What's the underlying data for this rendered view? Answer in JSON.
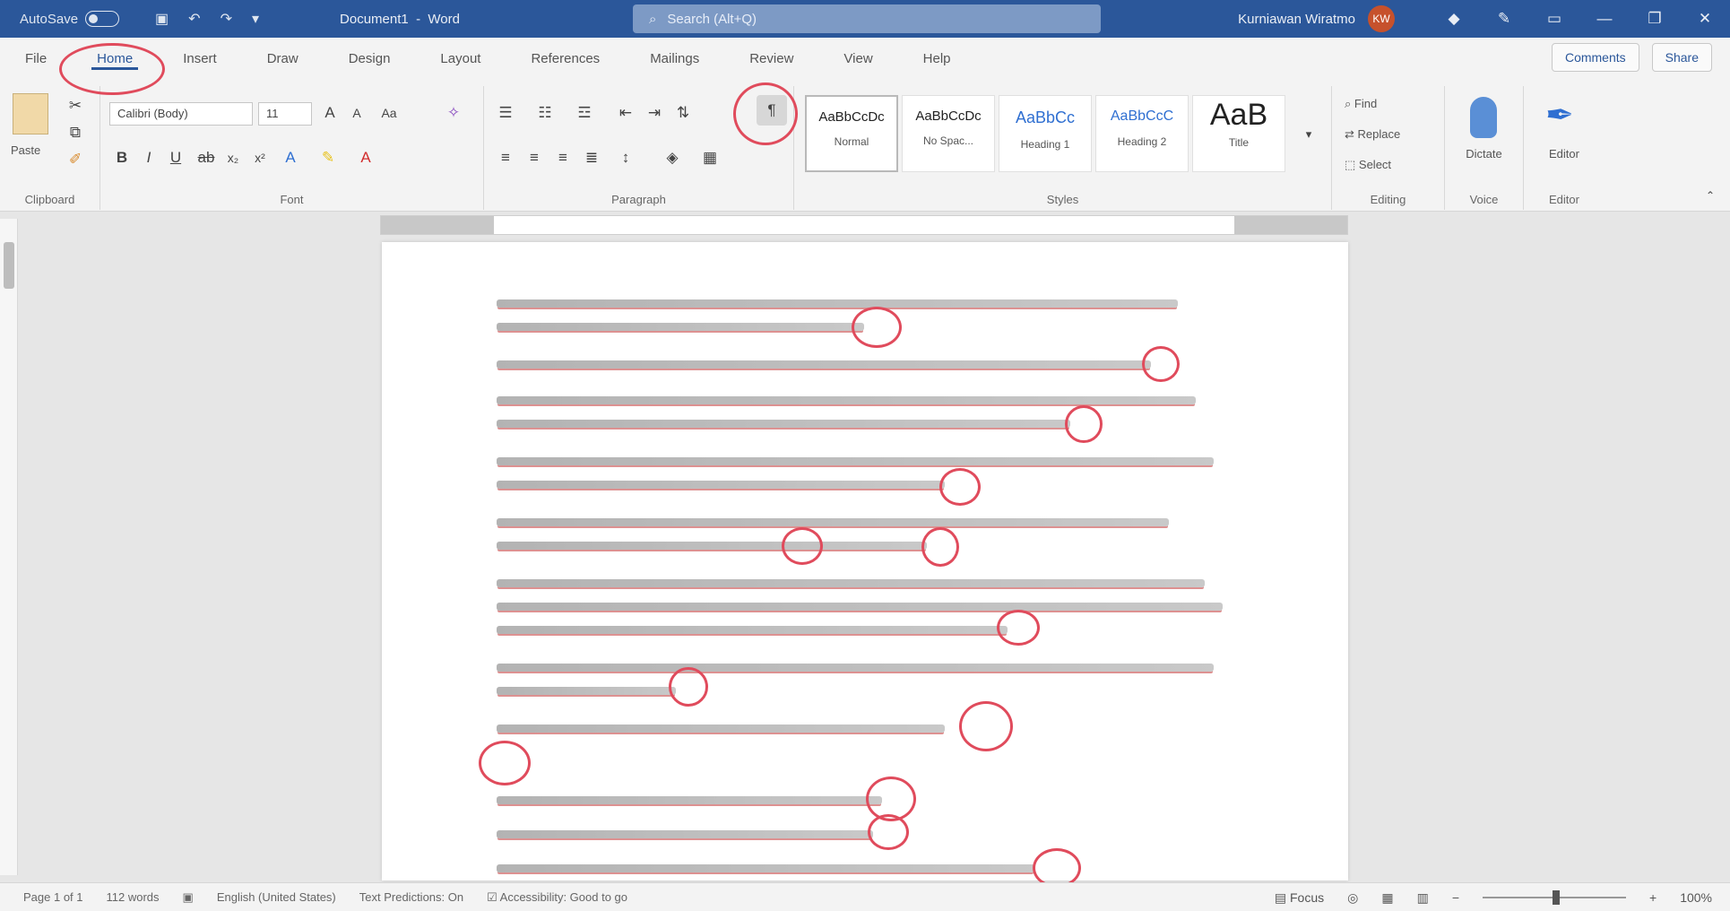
{
  "titlebar": {
    "autosave_label": "AutoSave",
    "autosave_state": "Off",
    "doc_title": "Document1",
    "app_name": "Word",
    "search_placeholder": "Search (Alt+Q)",
    "user_name": "Kurniawan Wiratmo",
    "user_initials": "KW"
  },
  "tabs": [
    {
      "label": "File"
    },
    {
      "label": "Home"
    },
    {
      "label": "Insert"
    },
    {
      "label": "Draw"
    },
    {
      "label": "Design"
    },
    {
      "label": "Layout"
    },
    {
      "label": "References"
    },
    {
      "label": "Mailings"
    },
    {
      "label": "Review"
    },
    {
      "label": "View"
    },
    {
      "label": "Help"
    }
  ],
  "tab_buttons": {
    "comments": "Comments",
    "share": "Share"
  },
  "ribbon": {
    "clipboard": {
      "label": "Clipboard",
      "paste": "Paste"
    },
    "font": {
      "label": "Font",
      "name": "Calibri (Body)",
      "size": "11"
    },
    "paragraph": {
      "label": "Paragraph"
    },
    "styles": {
      "label": "Styles",
      "items": [
        {
          "sample": "AaBbCcDc",
          "name": "Normal"
        },
        {
          "sample": "AaBbCcDc",
          "name": "No Spac..."
        },
        {
          "sample": "AaBbCc",
          "name": "Heading 1"
        },
        {
          "sample": "AaBbCcC",
          "name": "Heading 2"
        },
        {
          "sample": "AaB",
          "name": "Title"
        }
      ]
    },
    "editing": {
      "label": "Editing",
      "find": "Find",
      "replace": "Replace",
      "select": "Select"
    },
    "voice": {
      "label": "Voice",
      "dictate": "Dictate"
    },
    "editor": {
      "label": "Editor",
      "button": "Editor"
    }
  },
  "statusbar": {
    "page": "Page 1 of 1",
    "words": "112 words",
    "language": "English (United States)",
    "text_predictions": "Text Predictions: On",
    "accessibility": "Accessibility: Good to go",
    "focus": "Focus",
    "zoom": "100%"
  },
  "colors": {
    "titlebar": "#2b579a",
    "annotation_ring": "#e04b5c"
  }
}
